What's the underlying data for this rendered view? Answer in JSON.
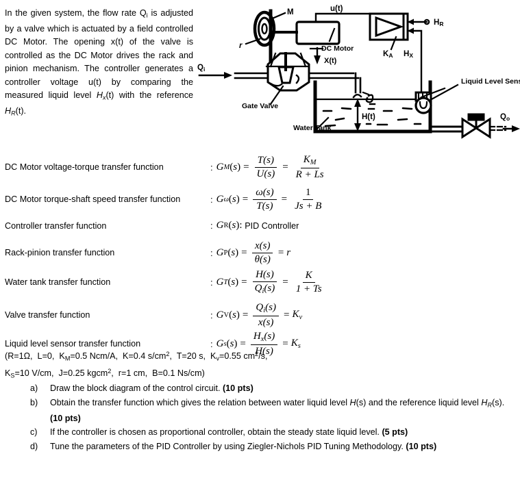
{
  "intro": {
    "segments": [
      {
        "t": "In the given system, the flow rate Q",
        "k": "plain"
      },
      {
        "t": "i",
        "k": "sub"
      },
      {
        "t": " is adjusted by a valve which is actuated by a field controlled DC Motor. The opening x(t) of the valve is controlled as the DC Motor drives the rack and pinion mechanism. The controller generates a controller voltage u(t) by comparing the measured liquid level ",
        "k": "plain"
      },
      {
        "t": "H",
        "k": "italic"
      },
      {
        "t": "x",
        "k": "isub"
      },
      {
        "t": "(t) with the reference ",
        "k": "plain"
      },
      {
        "t": "H",
        "k": "italic"
      },
      {
        "t": "R",
        "k": "isub"
      },
      {
        "t": "(t).",
        "k": "plain"
      }
    ]
  },
  "diagram": {
    "title": "control-system-schematic",
    "labels": {
      "m": "M",
      "r": "r",
      "u_t": "u(t)",
      "dc_motor": "DC Motor",
      "ka": "KA",
      "hr": "HR",
      "hx": "Hx",
      "qi": "Qi",
      "x_t": "X(t)",
      "gate_valve": "Gate Valve",
      "liquid_level_sensor": "Liquid Level Sensor",
      "water_tank": "Water Tank",
      "h_t": "H(t)",
      "qo": "Qo"
    },
    "line_color": "#000000"
  },
  "transfer_functions": [
    {
      "label": "DC Motor voltage-torque transfer function",
      "name": "G",
      "name_sub": "M",
      "numerator": "T(s)",
      "denominator": "U(s)",
      "rhs_numerator": "KM",
      "rhs_denominator": "R + Ls"
    },
    {
      "label": "DC Motor torque-shaft speed transfer function",
      "name": "G",
      "name_sub": "ω",
      "numerator": "ω(s)",
      "denominator": "T(s)",
      "rhs_numerator": "1",
      "rhs_denominator": "Js + B"
    },
    {
      "label": "Controller transfer function",
      "name": "G",
      "name_sub": "R",
      "plain_rhs": "PID Controller"
    },
    {
      "label": "Rack-pinion transfer function",
      "name": "G",
      "name_sub": "P",
      "numerator": "x(s)",
      "denominator": "θ(s)",
      "rhs_simple": "r"
    },
    {
      "label": "Water tank transfer function",
      "name": "G",
      "name_sub": "T",
      "numerator": "H(s)",
      "denominator": "Qi(s)",
      "rhs_numerator": "K",
      "rhs_denominator": "1 + Ts"
    },
    {
      "label": "Valve transfer function",
      "name": "G",
      "name_sub": "V",
      "numerator": "Qi(s)",
      "denominator": "x(s)",
      "rhs_simple": "Kv"
    },
    {
      "label": "Liquid level sensor transfer function",
      "name": "G",
      "name_sub": "s",
      "numerator": "Hx(s)",
      "denominator": "H(s)",
      "rhs_simple": "Ks"
    }
  ],
  "parameters": {
    "line1": "(R=1Ω,   L=0,   KM=0.5 Ncm/A,   K=0.4 s/cm²,   T=20 s,   Kv=0.55 cm²/s,",
    "line2": "Ks=10 V/cm,   J=0.25 kgcm²,   r=1 cm,   B=0.1 Ns/cm)",
    "items": [
      {
        "symbol": "R",
        "sub": "",
        "value": "1Ω"
      },
      {
        "symbol": "L",
        "sub": "",
        "value": "0"
      },
      {
        "symbol": "K",
        "sub": "M",
        "value": "0.5 Ncm/A"
      },
      {
        "symbol": "K",
        "sub": "",
        "value": "0.4 s/cm²"
      },
      {
        "symbol": "T",
        "sub": "",
        "value": "20 s"
      },
      {
        "symbol": "K",
        "sub": "v",
        "value": "0.55 cm²/s"
      },
      {
        "symbol": "K",
        "sub": "S",
        "value": "10 V/cm"
      },
      {
        "symbol": "J",
        "sub": "",
        "value": "0.25 kgcm²"
      },
      {
        "symbol": "r",
        "sub": "",
        "value": "1 cm"
      },
      {
        "symbol": "B",
        "sub": "",
        "value": "0.1 Ns/cm"
      }
    ]
  },
  "questions": [
    {
      "marker": "a)",
      "text": "Draw the block diagram of the control circuit. ",
      "points": "(10 pts)"
    },
    {
      "marker": "b)",
      "text_pre": "Obtain the transfer function which gives the relation between water liquid level ",
      "var1": "H",
      "text_mid": "(s) and the reference liquid level ",
      "var2": "H",
      "var2_sub": "R",
      "text_post": "(s). ",
      "points": "(10 pts)"
    },
    {
      "marker": "c)",
      "text": "If the controller is chosen as proportional controller, obtain the steady state liquid level. ",
      "points": "(5 pts)"
    },
    {
      "marker": "d)",
      "text": "Tune the parameters of the PID Controller by using Ziegler-Nichols PID Tuning Methodology. ",
      "points": "(10 pts)"
    }
  ]
}
